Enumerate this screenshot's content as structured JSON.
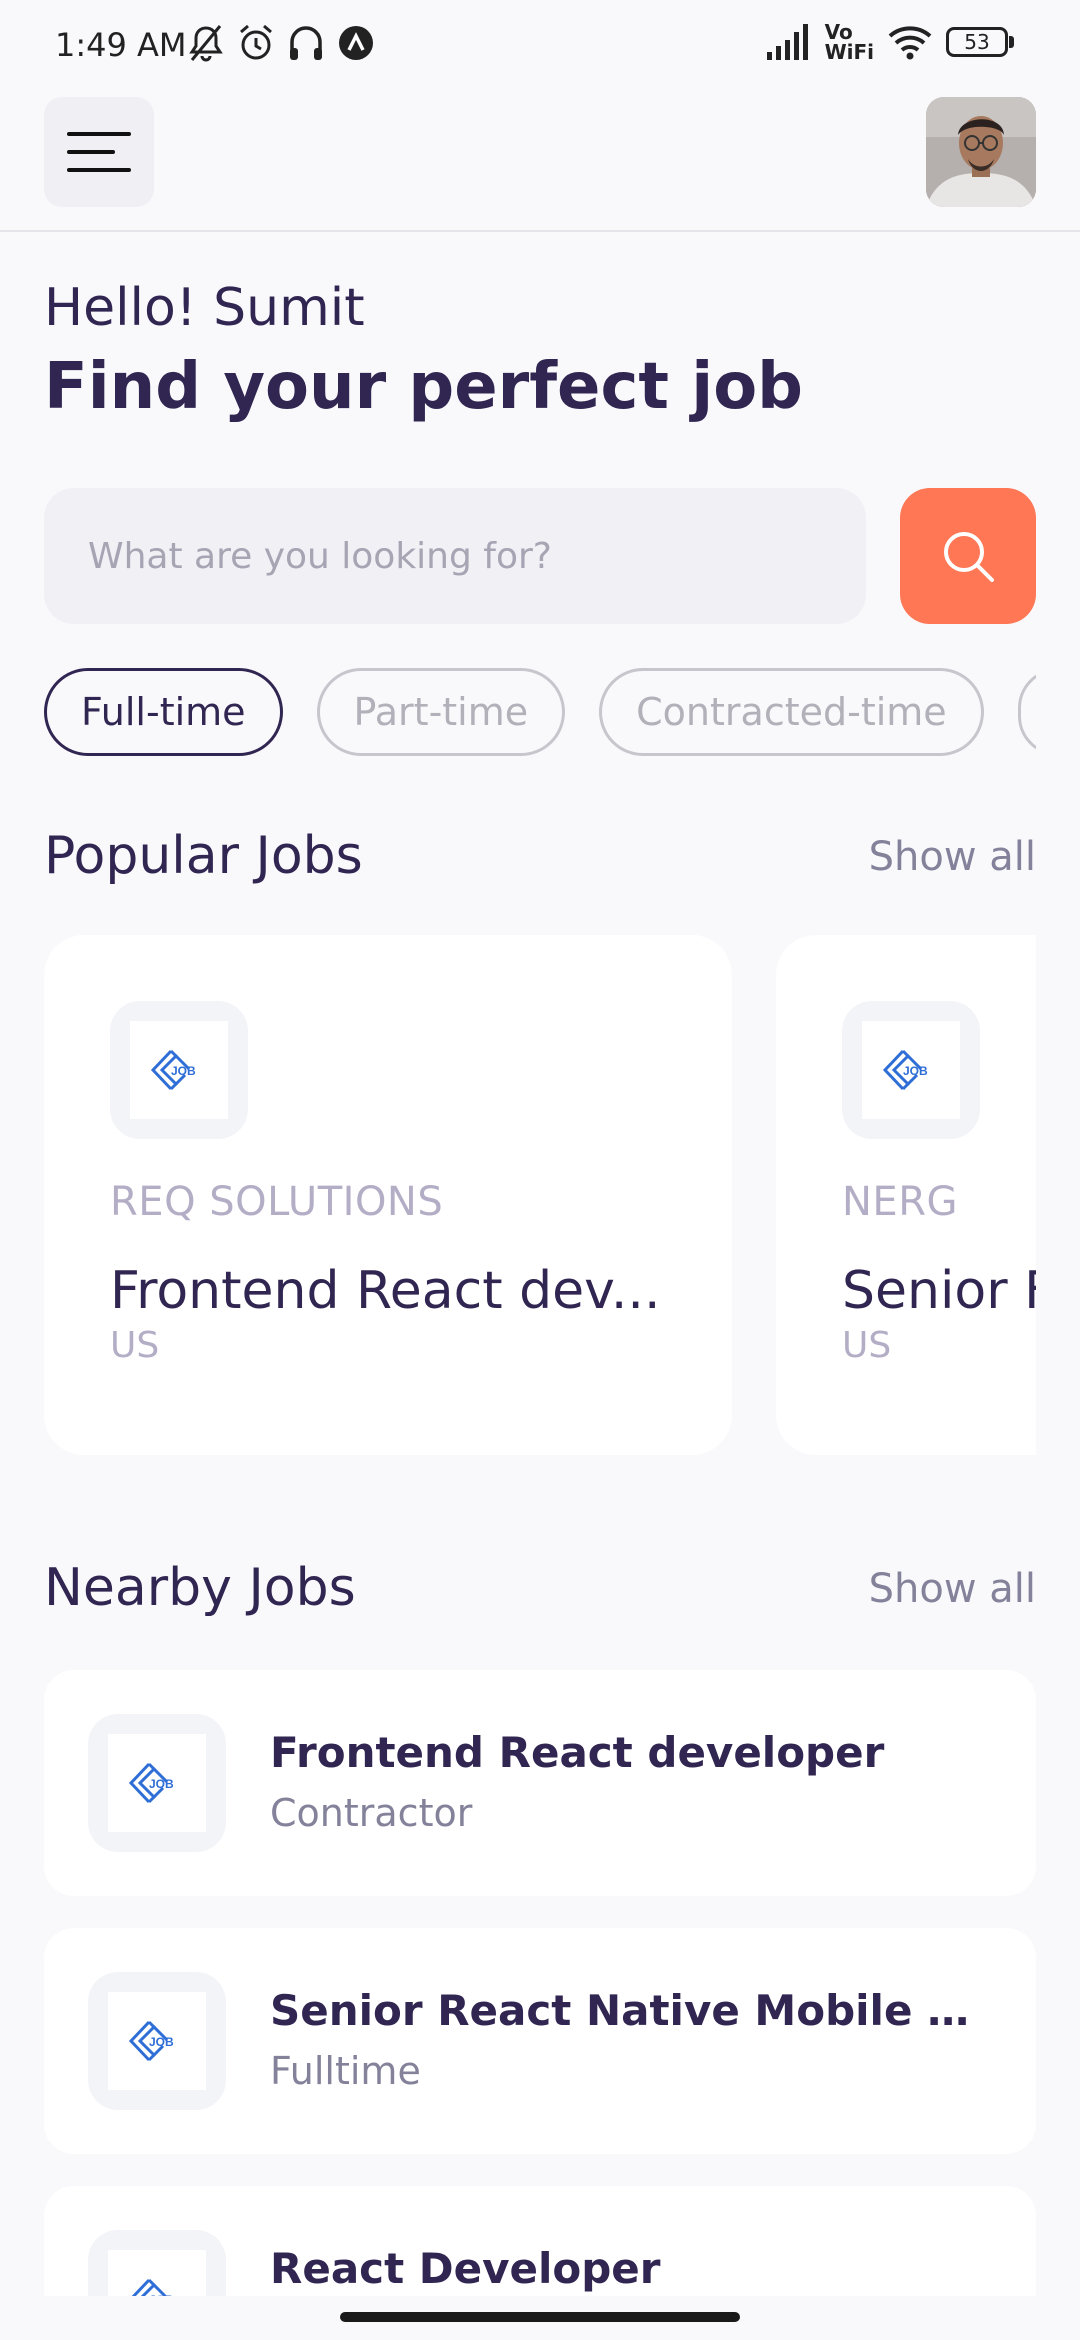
{
  "status_bar": {
    "time": "1:49 AM",
    "left_icons": [
      "muted-bell-icon",
      "alarm-icon",
      "headset-icon",
      "app-notification-icon"
    ],
    "right_icons": [
      "signal-icon",
      "vowifi-icon",
      "wifi-icon",
      "battery-icon"
    ],
    "vowifi_top": "Vo",
    "vowifi_bottom": "WiFi",
    "battery": "53"
  },
  "header": {
    "menu_icon": "hamburger-menu-icon",
    "avatar_icon": "profile-avatar"
  },
  "welcome": {
    "greeting": "Hello! Sumit",
    "headline": "Find your perfect job"
  },
  "search": {
    "placeholder": "What are you looking for?",
    "value": "",
    "button_icon": "search-icon"
  },
  "job_types": {
    "items": [
      "Full-time",
      "Part-time",
      "Contracted-time",
      ""
    ],
    "selected": "Full-time"
  },
  "popular": {
    "title": "Popular Jobs",
    "show_all": "Show all",
    "logo_text": "JOB",
    "jobs": [
      {
        "company": "REQ SOLUTIONS",
        "title": "Frontend React dev...",
        "location": "US"
      },
      {
        "company": "NERG",
        "title": "Senior F",
        "location": "US"
      }
    ]
  },
  "nearby": {
    "title": "Nearby Jobs",
    "show_all": "Show all",
    "jobs": [
      {
        "title": "Frontend React developer",
        "type": "Contractor"
      },
      {
        "title": "Senior React Native Mobile De...",
        "type": "Fulltime"
      },
      {
        "title": "React Developer",
        "type": ""
      }
    ]
  },
  "colors": {
    "primary": "#312651",
    "accent": "#ff7754",
    "gray": "#83829a",
    "background": "#f9f9fc",
    "logo_blue": "#2e6ed6"
  }
}
